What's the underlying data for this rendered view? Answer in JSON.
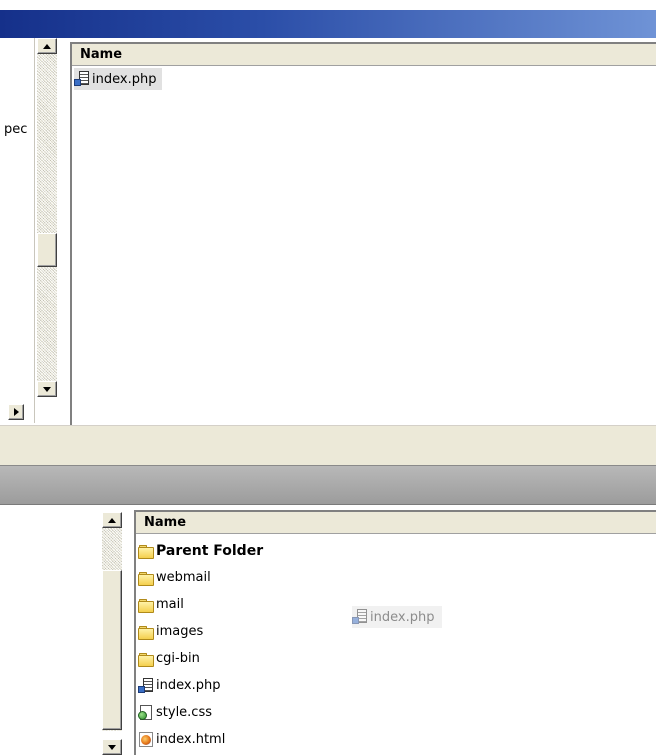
{
  "top_pane": {
    "tree_fragment": "pec",
    "column_header": "Name",
    "files": [
      {
        "label": "index.php",
        "icon": "php-file-icon",
        "selected": true
      }
    ]
  },
  "bottom_pane": {
    "column_header": "Name",
    "items": [
      {
        "label": "Parent Folder",
        "icon": "folder-icon",
        "bold": true
      },
      {
        "label": "webmail",
        "icon": "folder-icon"
      },
      {
        "label": "mail",
        "icon": "folder-icon"
      },
      {
        "label": "images",
        "icon": "folder-icon"
      },
      {
        "label": "cgi-bin",
        "icon": "folder-icon"
      },
      {
        "label": "index.php",
        "icon": "php-file-icon"
      },
      {
        "label": "style.css",
        "icon": "css-file-icon"
      },
      {
        "label": "index.html",
        "icon": "html-file-icon"
      }
    ]
  },
  "drag_ghost": {
    "label": "index.php",
    "icon": "php-file-icon"
  },
  "colors": {
    "title_bar": "#2b4ea8",
    "face": "#ece9d8",
    "selection": "#e1e1e1"
  }
}
